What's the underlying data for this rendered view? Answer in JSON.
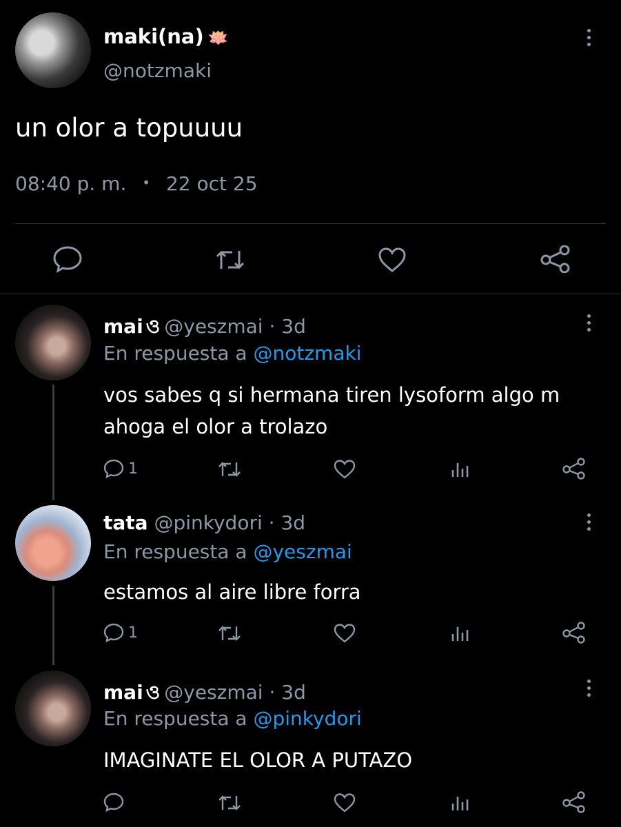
{
  "main_tweet": {
    "display_name": "maki(na)",
    "name_emoji": "🪷",
    "handle": "@notzmaki",
    "text": "un olor a topuuuu",
    "timestamp": "08:40 p. m.",
    "separator": "•",
    "date": "22 oct 25",
    "actions": [
      "comment-icon",
      "retweet-icon",
      "like-icon",
      "share-icon"
    ]
  },
  "replies": [
    {
      "display_name": "mai",
      "name_glyph": "ও",
      "handle": "@yeszmai",
      "dot": "·",
      "age": "3d",
      "reply_prefix": "En respuesta a",
      "reply_to": "@notzmaki",
      "text": "vos sabes q si hermana tiren lysoform algo m ahoga el olor a trolazo",
      "reply_count": "1"
    },
    {
      "display_name": "tata",
      "handle": "@pinkydori",
      "dot": "·",
      "age": "3d",
      "reply_prefix": "En respuesta a",
      "reply_to": "@yeszmai",
      "text": "estamos al aire libre forra",
      "reply_count": "1"
    },
    {
      "display_name": "mai",
      "name_glyph": "ও",
      "handle": "@yeszmai",
      "dot": "·",
      "age": "3d",
      "reply_prefix": "En respuesta a",
      "reply_to": "@pinkydori",
      "text": "IMAGINATE EL OLOR A PUTAZO",
      "reply_count": ""
    }
  ],
  "colors": {
    "background": "#000000",
    "text": "#ffffff",
    "muted": "#8b98a5",
    "link": "#1d9bf0",
    "divider": "#2f3336"
  }
}
